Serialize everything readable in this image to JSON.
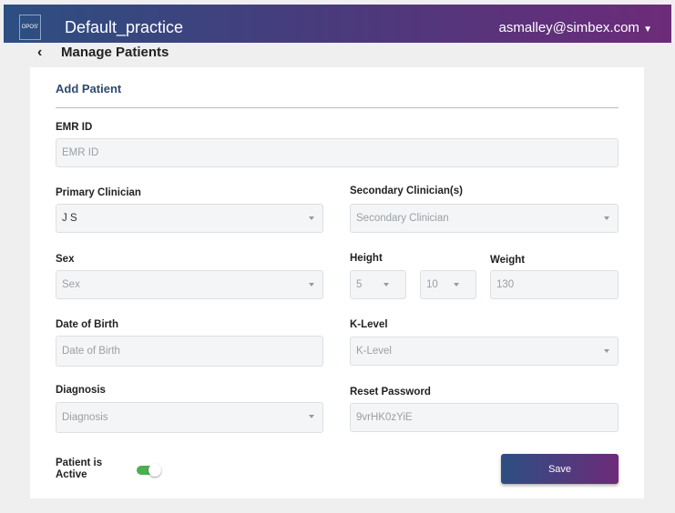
{
  "header": {
    "logo": "OPOS'",
    "app_title": "Default_practice",
    "user": "asmalley@simbex.com"
  },
  "breadcrumb": {
    "title": "Manage Patients"
  },
  "form": {
    "title": "Add Patient",
    "emr": {
      "label": "EMR ID",
      "placeholder": "EMR ID"
    },
    "primary": {
      "label": "Primary Clinician",
      "value": "J S"
    },
    "secondary": {
      "label": "Secondary Clinician(s)",
      "placeholder": "Secondary Clinician"
    },
    "sex": {
      "label": "Sex",
      "placeholder": "Sex"
    },
    "height": {
      "label": "Height",
      "feet": "5",
      "inches": "10"
    },
    "weight": {
      "label": "Weight",
      "value": "130"
    },
    "dob": {
      "label": "Date of Birth",
      "placeholder": "Date of Birth"
    },
    "klevel": {
      "label": "K-Level",
      "placeholder": "K-Level"
    },
    "diagnosis": {
      "label": "Diagnosis",
      "placeholder": "Diagnosis"
    },
    "password": {
      "label": "Reset Password",
      "value": "9vrHK0zYiE"
    },
    "active": {
      "label": "Patient is Active",
      "on": true
    },
    "save": "Save"
  }
}
